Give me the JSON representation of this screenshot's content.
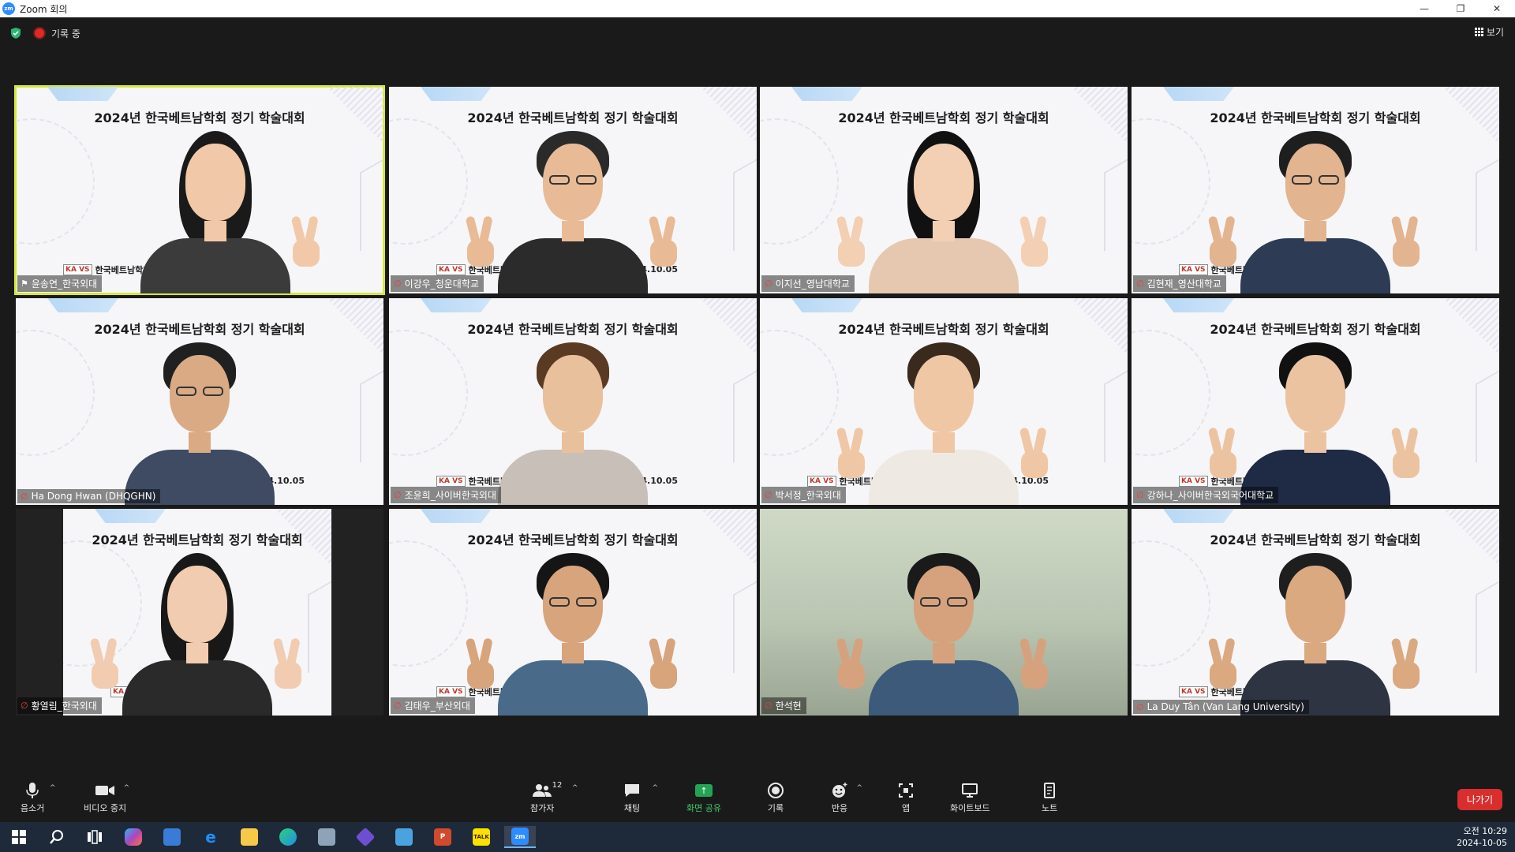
{
  "window": {
    "app_icon": "zm",
    "title": "Zoom 회의",
    "controls": [
      "minimize-icon",
      "restore-icon",
      "close-icon"
    ]
  },
  "status": {
    "recording_label": "기록 중",
    "view_label": "보기"
  },
  "banner_text": "2024년 한국베트남학회 정기 학술대회",
  "date_text": "2024.10.05",
  "logo": {
    "mark": "KA VS",
    "text": "한국베트남학회"
  },
  "participants": [
    {
      "name": "윤송연_한국외대",
      "active": true,
      "pinned": true
    },
    {
      "name": "이강우_청운대학교"
    },
    {
      "name": "이지선_영남대학교"
    },
    {
      "name": "김현재_영산대학교"
    },
    {
      "name": "Ha Dong Hwan (DHQGHN)"
    },
    {
      "name": "조윤희_사이버한국외대"
    },
    {
      "name": "박서정_한국외대"
    },
    {
      "name": "강하나_사이버한국외국어대학교"
    },
    {
      "name": "황열림_한국외대"
    },
    {
      "name": "김태우_부산외대"
    },
    {
      "name": "한석현"
    },
    {
      "name": "La Duy Tân (Van Lang University)"
    }
  ],
  "toolbar": {
    "mute_label": "음소거",
    "video_label": "비디오 중지",
    "participants_label": "참가자",
    "participants_count": "12",
    "chat_label": "채팅",
    "share_label": "화면 공유",
    "record_label": "기록",
    "reactions_label": "반응",
    "apps_label": "앱",
    "whiteboard_label": "화이트보드",
    "notes_label": "노트",
    "leave_label": "나가기"
  },
  "taskbar": {
    "time": "오전 10:29",
    "date": "2024-10-05",
    "apps": [
      "windows-start",
      "search",
      "task-view",
      "copilot",
      "store",
      "internet-explorer",
      "file-explorer",
      "edge",
      "mail",
      "media-player",
      "notepad",
      "powerpoint",
      "kakaotalk",
      "zoom"
    ]
  },
  "colors": {
    "active_speaker": "#d6e83a",
    "leave": "#d92e2e",
    "share": "#23a455",
    "taskbar": "#1e2a3a"
  }
}
